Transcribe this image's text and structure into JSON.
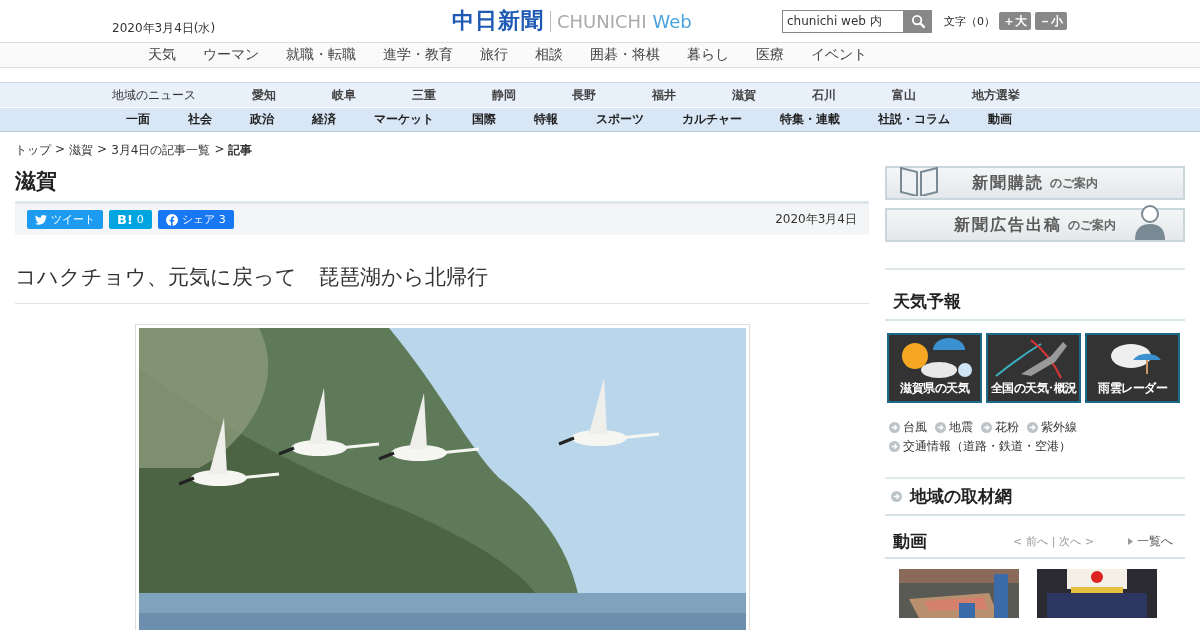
{
  "header": {
    "date": "2020年3月4日(水)",
    "logo_main": "中日新聞",
    "logo_sub": "CHUNICHI",
    "logo_web": "Web",
    "search": {
      "value": "chunichi web 内"
    },
    "font_size": {
      "label": "文字（0）",
      "larger": "＋大",
      "smaller": "－小"
    }
  },
  "top_menu": [
    "天気",
    "ウーマン",
    "就職・転職",
    "進学・教育",
    "旅行",
    "相談",
    "囲碁・将棋",
    "暮らし",
    "医療",
    "イベント"
  ],
  "region_nav": {
    "label": "地域のニュース",
    "items": [
      "愛知",
      "岐阜",
      "三重",
      "静岡",
      "長野",
      "福井",
      "滋賀",
      "石川",
      "富山",
      "地方選挙"
    ]
  },
  "section_nav": [
    "一面",
    "社会",
    "政治",
    "経済",
    "マーケット",
    "国際",
    "特報",
    "スポーツ",
    "カルチャー",
    "特集・連載",
    "社説・コラム",
    "動画"
  ],
  "breadcrumb_separator": ">",
  "breadcrumb": [
    {
      "label": "トップ",
      "current": false
    },
    {
      "label": "滋賀",
      "current": false
    },
    {
      "label": "3月4日の記事一覧",
      "current": false
    },
    {
      "label": "記事",
      "current": true
    }
  ],
  "section_title": "滋賀",
  "share": [
    {
      "kind": "twitter",
      "label": "ツイート"
    },
    {
      "kind": "hatena",
      "label": "B!",
      "count": "0"
    },
    {
      "kind": "facebook",
      "label": "シェア",
      "count": "3"
    }
  ],
  "article": {
    "date": "2020年3月4日",
    "headline": "コハクチョウ、元気に戻って　琵琶湖から北帰行"
  },
  "sidebar": {
    "banners": [
      {
        "kind": "subscribe",
        "title": "新聞購読",
        "suffix": "のご案内"
      },
      {
        "kind": "advertise",
        "title": "新聞広告出稿",
        "suffix": "のご案内"
      }
    ],
    "weather": {
      "title": "天気予報",
      "tiles": [
        {
          "kind": "sun",
          "label": "滋賀県の天気"
        },
        {
          "kind": "map",
          "label": "全国の天気･概況"
        },
        {
          "kind": "rain",
          "label": "雨雲レーダー"
        }
      ],
      "links": [
        "台風",
        "地震",
        "花粉",
        "紫外線",
        "交通情報（道路・鉄道・空港）"
      ]
    },
    "regional": {
      "title": "地域の取材網"
    },
    "video": {
      "title": "動画",
      "prev": "< 前へ",
      "divider": "|",
      "next": "次へ >",
      "list": "一覧へ",
      "thumbs": [
        {
          "kind": "boat"
        },
        {
          "kind": "group"
        }
      ]
    }
  }
}
